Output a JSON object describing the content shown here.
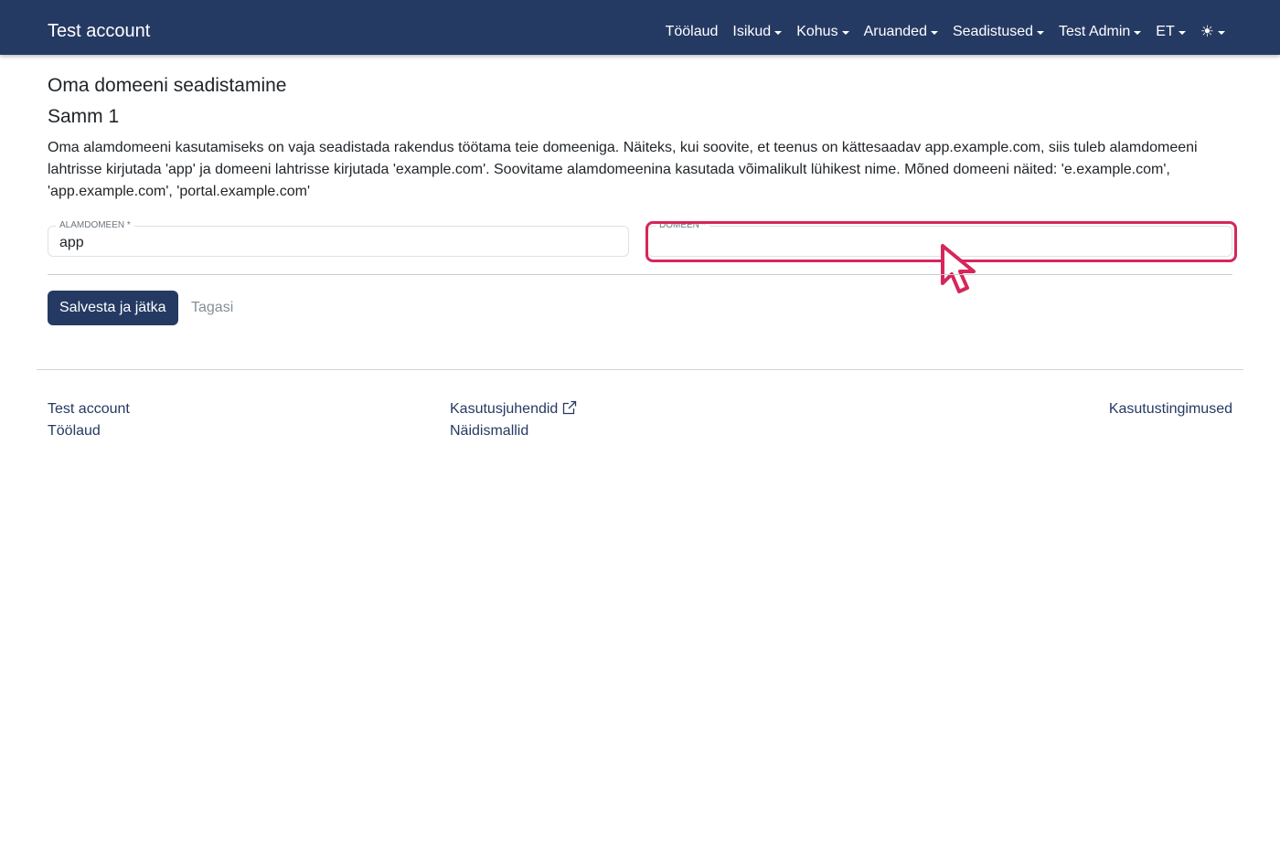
{
  "navbar": {
    "brand": "Test account",
    "items": [
      {
        "label": "Töölaud",
        "dropdown": false
      },
      {
        "label": "Isikud",
        "dropdown": true
      },
      {
        "label": "Kohus",
        "dropdown": true
      },
      {
        "label": "Aruanded",
        "dropdown": true
      },
      {
        "label": "Seadistused",
        "dropdown": true
      },
      {
        "label": "Test Admin",
        "dropdown": true
      },
      {
        "label": "ET",
        "dropdown": true
      }
    ],
    "theme_icon": "sun-icon",
    "theme_symbol": "☀"
  },
  "page": {
    "title": "Oma domeeni seadistamine",
    "step_title": "Samm 1",
    "description": "Oma alamdomeeni kasutamiseks on vaja seadistada rakendus töötama teie domeeniga. Näiteks, kui soovite, et teenus on kättesaadav app.example.com, siis tuleb alamdomeeni lahtrisse kirjutada 'app' ja domeeni lahtrisse kirjutada 'example.com'. Soovitame alamdomeenina kasutada võimalikult lühikest nime. Mõned domeeni näited: 'e.example.com', 'app.example.com', 'portal.example.com'"
  },
  "form": {
    "subdomain": {
      "label": "ALAMDOMEEN *",
      "value": "app"
    },
    "domain": {
      "label": "DOMEEN *",
      "value": ""
    },
    "save_label": "Salvesta ja jätka",
    "back_label": "Tagasi"
  },
  "footer": {
    "col1": [
      "Test account",
      "Töölaud"
    ],
    "col2": [
      "Kasutusjuhendid",
      "Näidismallid"
    ],
    "col3": [
      "Kasutustingimused"
    ]
  },
  "colors": {
    "navbar": "#253a63",
    "primary_button": "#253a63",
    "highlight": "#d6265a"
  }
}
